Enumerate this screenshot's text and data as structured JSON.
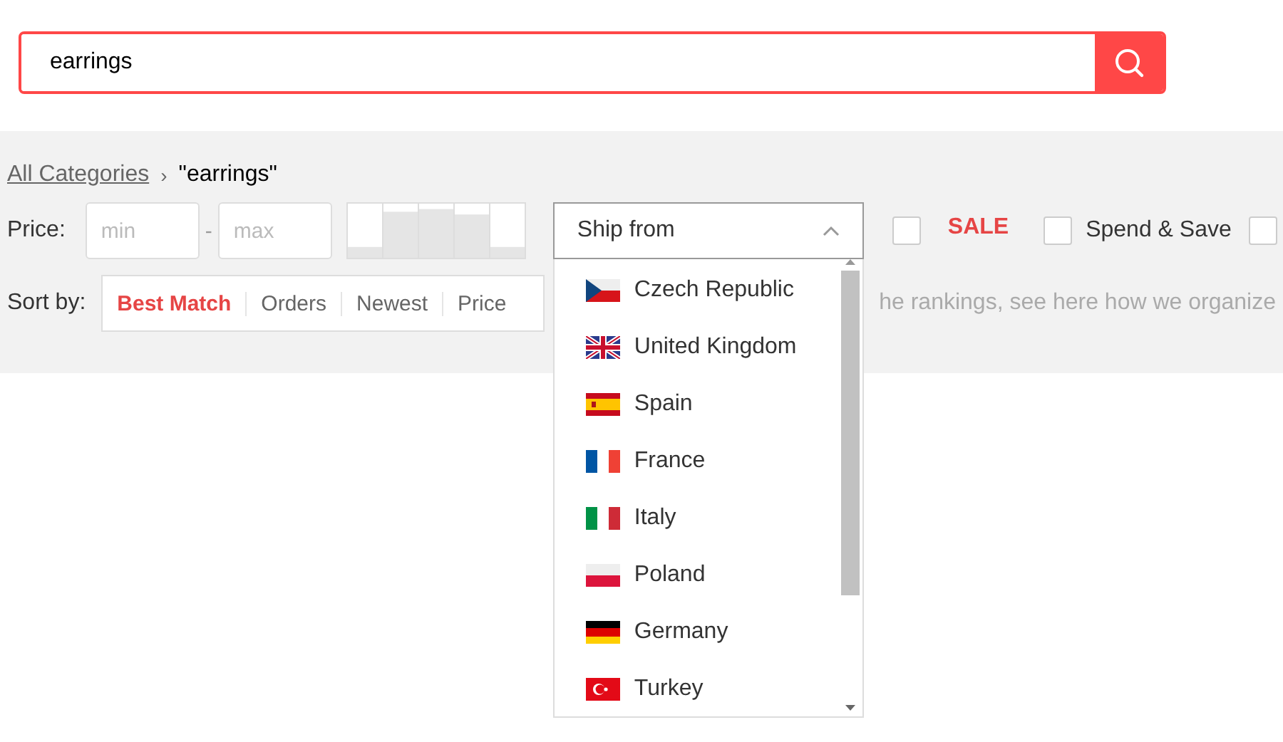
{
  "search": {
    "value": "earrings"
  },
  "breadcrumb": {
    "root": "All Categories",
    "separator": "›",
    "current": "\"earrings\""
  },
  "price": {
    "label": "Price:",
    "min_placeholder": "min",
    "dash": "-",
    "max_placeholder": "max"
  },
  "ship_from": {
    "label": "Ship from",
    "expanded": true,
    "options": [
      {
        "label": "Czech Republic"
      },
      {
        "label": "United Kingdom"
      },
      {
        "label": "Spain"
      },
      {
        "label": "France"
      },
      {
        "label": "Italy"
      },
      {
        "label": "Poland"
      },
      {
        "label": "Germany"
      },
      {
        "label": "Turkey"
      }
    ]
  },
  "filters": [
    {
      "label": "SALE",
      "kind": "sale",
      "checked": false
    },
    {
      "label": "Spend & Save",
      "kind": "plain",
      "checked": false
    },
    {
      "kind": "plain",
      "checked": false
    }
  ],
  "sort": {
    "label": "Sort by:",
    "options": [
      {
        "label": "Best Match",
        "selected": true
      },
      {
        "label": "Orders",
        "selected": false
      },
      {
        "label": "Newest",
        "selected": false
      },
      {
        "label": "Price",
        "selected": false
      }
    ],
    "note": "he rankings, see here how we organize"
  }
}
